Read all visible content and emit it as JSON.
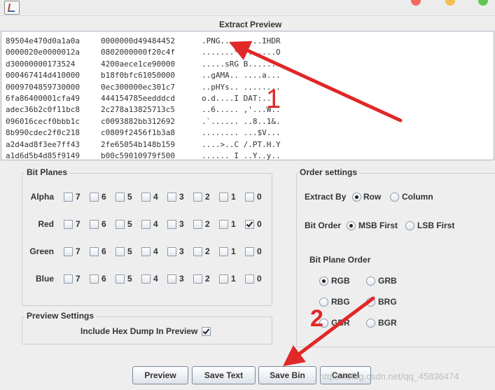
{
  "window": {
    "traffic_lights": [
      "#ef6b60",
      "#f4bf4f",
      "#61c554"
    ]
  },
  "preview": {
    "title": "Extract Preview",
    "rows": [
      {
        "hex1": "89504e470d0a1a0a",
        "hex2": "0000000d49484452",
        "ascii": ".PNG.... ....IHDR"
      },
      {
        "hex1": "0000020e0000012a",
        "hex2": "0802000000f20c4f",
        "ascii": ".......* .......O"
      },
      {
        "hex1": "d30000000173524",
        "hex2": "4200aece1ce90000",
        "ascii": ".....sRG B......."
      },
      {
        "hex1": "000467414d410000",
        "hex2": "b18f0bfc61050000",
        "ascii": "..gAMA.. ....a..."
      },
      {
        "hex1": "0009704859730000",
        "hex2": "0ec300000ec301c7",
        "ascii": "..pHYs.. ........"
      },
      {
        "hex1": "6fa86400001cfa49",
        "hex2": "444154785eedddcd",
        "ascii": "o.d....I DAT:..."
      },
      {
        "hex1": "adec36b2c0f11bc8",
        "hex2": "2c278a13825713c5",
        "ascii": "..6..... ,'...W.."
      },
      {
        "hex1": "096016cecf0bbb1c",
        "hex2": "c0093882bb312692",
        "ascii": ".`...... ..8..1&."
      },
      {
        "hex1": "8b990cdec2f0c218",
        "hex2": "c0809f2456f1b3a8",
        "ascii": "........ ...$V..."
      },
      {
        "hex1": "a2d4ad8f3ee7ff43",
        "hex2": "2fe65054b148b159",
        "ascii": "....>..C /.PT.H.Y"
      },
      {
        "hex1": "a1d6d5b4d85f9149",
        "hex2": "b00c59010979f500",
        "ascii": "......_I ..Y..y.."
      }
    ]
  },
  "bit_planes": {
    "title": "Bit Planes",
    "bits": [
      "7",
      "6",
      "5",
      "4",
      "3",
      "2",
      "1",
      "0"
    ],
    "channels": [
      {
        "label": "Alpha",
        "checked": []
      },
      {
        "label": "Red",
        "checked": [
          "0"
        ]
      },
      {
        "label": "Green",
        "checked": []
      },
      {
        "label": "Blue",
        "checked": []
      }
    ]
  },
  "preview_settings": {
    "title": "Preview Settings",
    "hex_dump_label": "Include Hex Dump In Preview",
    "hex_dump_checked": true
  },
  "order_settings": {
    "title": "Order settings",
    "extract_by_label": "Extract By",
    "extract_by_options": [
      "Row",
      "Column"
    ],
    "extract_by_selected": "Row",
    "bit_order_label": "Bit Order",
    "bit_order_options": [
      "MSB First",
      "LSB First"
    ],
    "bit_order_selected": "MSB First",
    "bit_plane_order_label": "Bit Plane Order",
    "bit_plane_order_options": [
      "RGB",
      "GRB",
      "RBG",
      "BRG",
      "GBR",
      "BGR"
    ],
    "bit_plane_order_selected": "RGB"
  },
  "buttons": {
    "preview": "Preview",
    "save_text": "Save Text",
    "save_bin": "Save Bin",
    "cancel": "Cancel"
  },
  "annotations": {
    "label_1": "1",
    "label_2": "2",
    "color": "#e02828"
  },
  "watermark": "https://blog.csdn.net/qq_45836474"
}
